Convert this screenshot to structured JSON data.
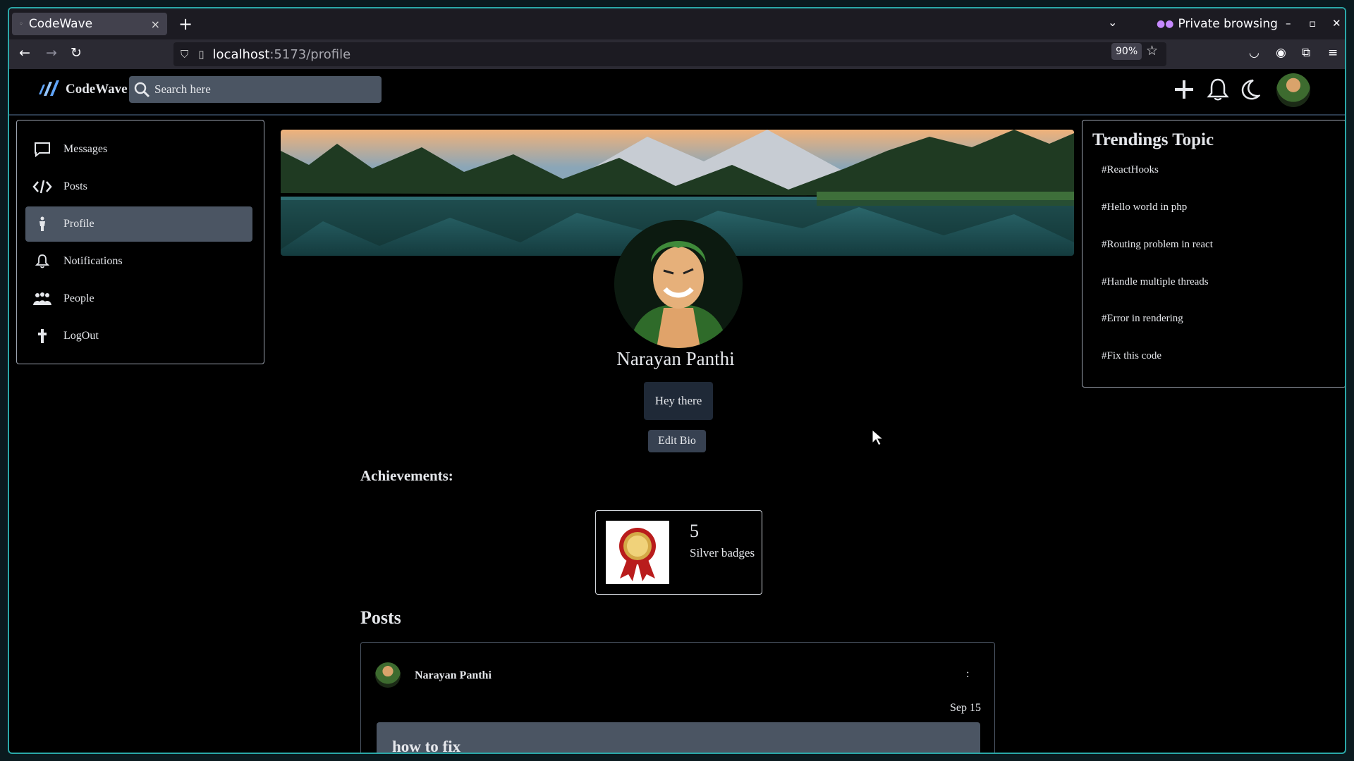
{
  "browser": {
    "tab_title": "CodeWave",
    "tab_close": "×",
    "new_tab": "+",
    "private_label": "Private browsing",
    "url_host": "localhost",
    "url_path": ":5173/profile",
    "zoom": "90%"
  },
  "header": {
    "brand": "CodeWave",
    "search_placeholder": "Search here"
  },
  "sidebar": {
    "items": [
      {
        "label": "Messages"
      },
      {
        "label": "Posts"
      },
      {
        "label": "Profile"
      },
      {
        "label": "Notifications"
      },
      {
        "label": "People"
      },
      {
        "label": "LogOut"
      }
    ],
    "active_index": 2
  },
  "profile": {
    "name": "Narayan Panthi",
    "bio": "Hey there",
    "edit_bio_label": "Edit Bio",
    "achievements_title": "Achievements:",
    "badge": {
      "count": "5",
      "label": "Silver badges"
    }
  },
  "posts": {
    "title": "Posts",
    "items": [
      {
        "author": "Narayan Panthi",
        "menu": ":",
        "date": "Sep 15",
        "title": "how to fix"
      }
    ]
  },
  "trending": {
    "title": "Trendings Topic",
    "topics": [
      "#ReactHooks",
      "#Hello world in php",
      "#Routing problem in react",
      "#Handle multiple threads",
      "#Error in rendering",
      "#Fix this code"
    ]
  },
  "colors": {
    "frame_accent": "#2aa8a8",
    "panel_gray": "#4b5563",
    "text": "#e5e7eb"
  }
}
